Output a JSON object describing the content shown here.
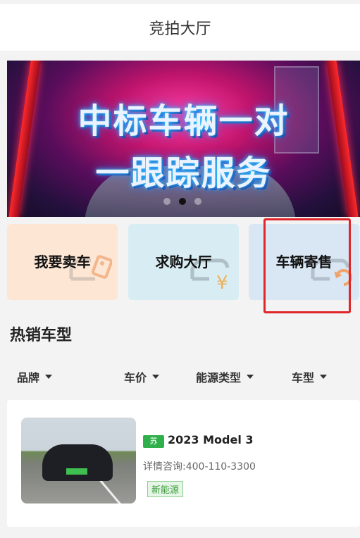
{
  "header": {
    "title": "竞拍大厅"
  },
  "banner": {
    "line1": "中标车辆一对",
    "line2": "一跟踪服务",
    "dots": 3,
    "active_dot": 2
  },
  "quick_actions": [
    {
      "label": "我要卖车",
      "icon": "car-tag-icon"
    },
    {
      "label": "求购大厅",
      "icon": "car-yen-icon"
    },
    {
      "label": "车辆寄售",
      "icon": "car-refresh-icon"
    }
  ],
  "section": {
    "title": "热销车型"
  },
  "filters": [
    {
      "label": "品牌"
    },
    {
      "label": "车价"
    },
    {
      "label": "能源类型"
    },
    {
      "label": "车型"
    }
  ],
  "listing": {
    "plate_region": "苏",
    "title": "2023 Model 3",
    "contact": "详情咨询:400-110-3300",
    "energy_tag": "新能源"
  },
  "colors": {
    "highlight_border": "#e0262a",
    "card_sell_bg": "#fde6d4",
    "card_buy_bg": "#d8edf3",
    "card_consign_bg": "#d9e6f3",
    "plate_green": "#2fb04a"
  }
}
